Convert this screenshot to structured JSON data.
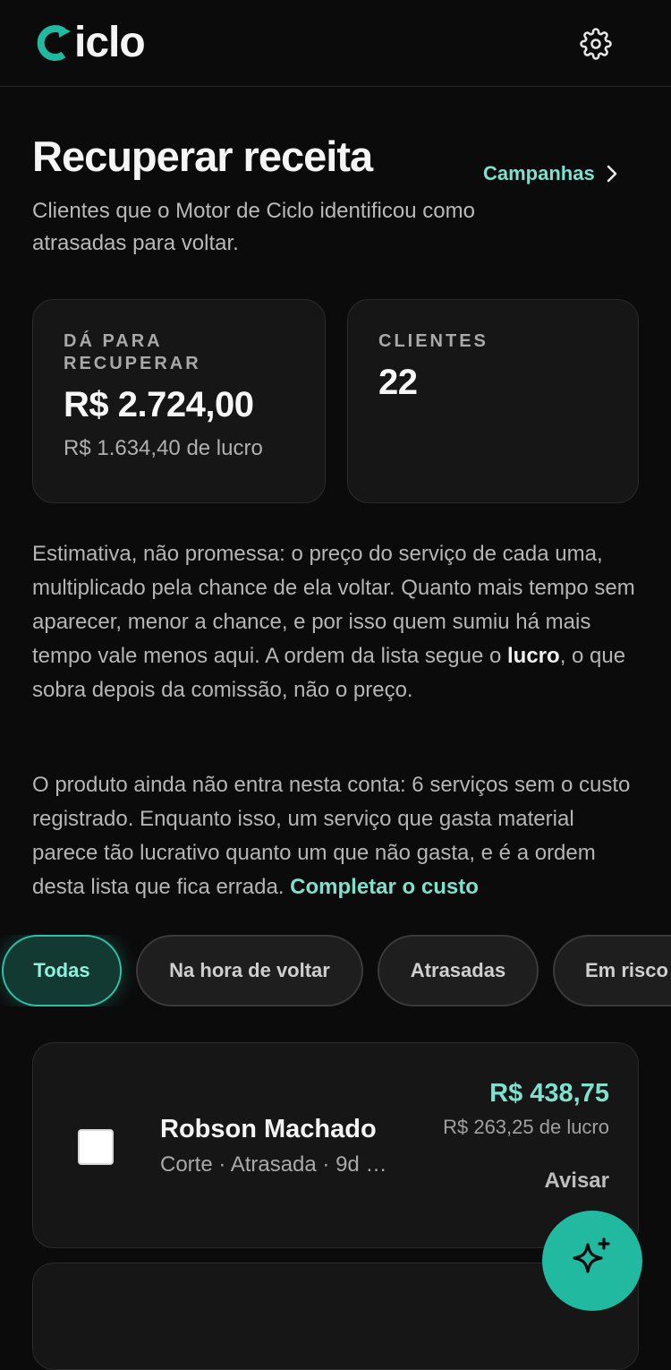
{
  "app": {
    "logo_text": "iclo",
    "brand_color": "#22b9a1"
  },
  "header": {
    "settings_icon": "gear-icon"
  },
  "page": {
    "title": "Recuperar receita",
    "campaigns_link": "Campanhas",
    "subtitle": "Clientes que o Motor de Ciclo identificou como atrasadas para voltar."
  },
  "stats": {
    "recover_label": "DÁ PARA RECUPERAR",
    "recover_value": "R$ 2.724,00",
    "recover_profit": "R$ 1.634,40 de lucro",
    "clients_label": "CLIENTES",
    "clients_value": "22"
  },
  "explainer": {
    "p1_before": "Estimativa, não promessa: o preço do serviço de cada uma, multiplicado pela chance de ela voltar. Quanto mais tempo sem aparecer, menor a chance, e por isso quem sumiu há mais tempo vale menos aqui. A ordem da lista segue o ",
    "p1_bold": "lucro",
    "p1_after": ", o que sobra depois da comissão, não o preço.",
    "p2_text": "O produto ainda não entra nesta conta: 6 serviços sem o custo registrado. Enquanto isso, um serviço que gasta material parece tão lucrativo quanto um que não gasta, e é a ordem desta lista que fica errada. ",
    "p2_link": "Completar o custo"
  },
  "filters": [
    {
      "label": "Todas",
      "active": true
    },
    {
      "label": "Na hora de voltar",
      "active": false
    },
    {
      "label": "Atrasadas",
      "active": false
    },
    {
      "label": "Em risco",
      "active": false
    }
  ],
  "clients": [
    {
      "name": "Robson Machado",
      "meta": "Corte · Atrasada · 9d …",
      "value": "R$ 438,75",
      "profit": "R$ 263,25 de lucro",
      "action": "Avisar"
    }
  ],
  "fab": {
    "icon": "sparkles-icon"
  }
}
